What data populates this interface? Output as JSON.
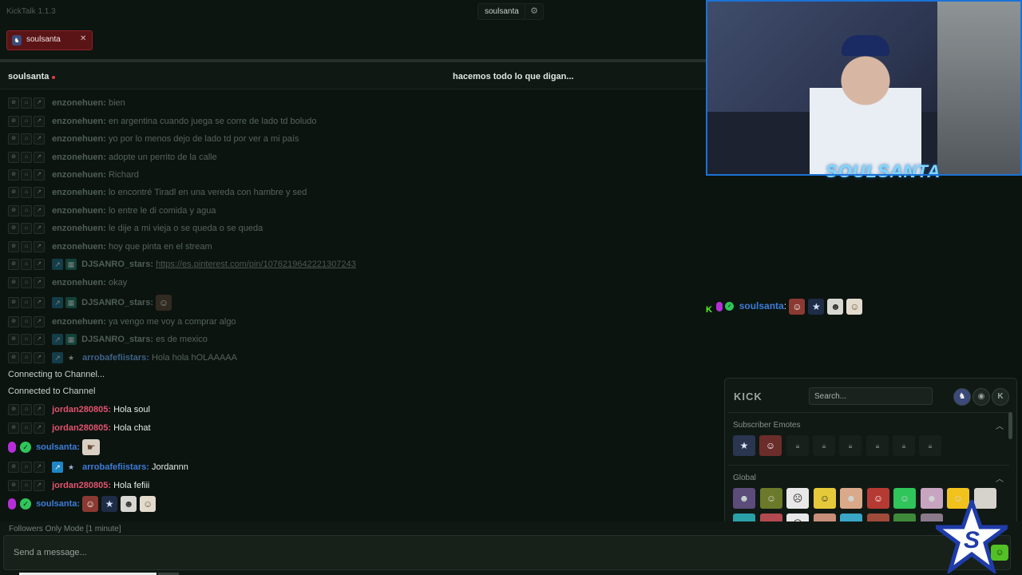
{
  "app": {
    "title": "KickTalk 1.1.3",
    "active_user": "soulsanta"
  },
  "tabs": [
    {
      "label": "soulsanta"
    }
  ],
  "channel": {
    "name": "soulsanta",
    "stream_title": "hacemos todo lo que digan..."
  },
  "messages": [
    {
      "user": "enzonehuen:",
      "text": "bien"
    },
    {
      "user": "enzonehuen:",
      "text": "en argentina cuando juega se corre de lado td boludo"
    },
    {
      "user": "enzonehuen:",
      "text": "yo por lo menos dejo de lado td por ver a mi país"
    },
    {
      "user": "enzonehuen:",
      "text": "adopte un perrito de la calle"
    },
    {
      "user": "enzonehuen:",
      "text": "Richard"
    },
    {
      "user": "enzonehuen:",
      "text": "lo encontré Tiradl en una vereda con hambre y sed"
    },
    {
      "user": "enzonehuen:",
      "text": "lo entre le di comida y agua"
    },
    {
      "user": "enzonehuen:",
      "text": "le dije a mi vieja o se queda o se queda"
    },
    {
      "user": "enzonehuen:",
      "text": "hoy que pinta en el stream"
    },
    {
      "user": "DJSANRO_stars:",
      "text": "https://es.pinterest.com/pin/1076219642221307243"
    },
    {
      "user": "enzonehuen:",
      "text": "okay"
    },
    {
      "user": "DJSANRO_stars:",
      "text": ""
    },
    {
      "user": "enzonehuen:",
      "text": "ya vengo me voy a comprar algo"
    },
    {
      "user": "DJSANRO_stars:",
      "text": "es de mexico"
    },
    {
      "user": "arrobafefiistars:",
      "text": "Hola hola hOLAAAAA"
    }
  ],
  "system": {
    "connecting": "Connecting to Channel...",
    "connected": "Connected to Channel"
  },
  "live_messages": [
    {
      "user": "jordan280805:",
      "text": "Hola soul"
    },
    {
      "user": "jordan280805:",
      "text": "Hola chat"
    },
    {
      "user": "soulsanta:",
      "text": ""
    },
    {
      "user": "arrobafefiistars:",
      "text": "Jordannn"
    },
    {
      "user": "jordan280805:",
      "text": "Hola fefiii"
    },
    {
      "user": "soulsanta:",
      "text": ""
    }
  ],
  "overlay": {
    "user": "soulsanta",
    "separator": ":"
  },
  "video": {
    "logo_text": "SOULSANTA"
  },
  "emote_panel": {
    "logo": "KICK",
    "search_placeholder": "Search...",
    "sections": {
      "subscriber": "Subscriber Emotes",
      "global": "Global"
    }
  },
  "input": {
    "mode": "Followers Only Mode [1 minute]",
    "placeholder": "Send a message..."
  },
  "icons": {
    "settings": "gear-icon",
    "close": "close-icon",
    "send": "emote-icon"
  },
  "colors": {
    "accent": "#53fc18",
    "username_pink": "#e2536e",
    "username_blue": "#3b7dd8",
    "tab_bg": "#5a1416"
  }
}
